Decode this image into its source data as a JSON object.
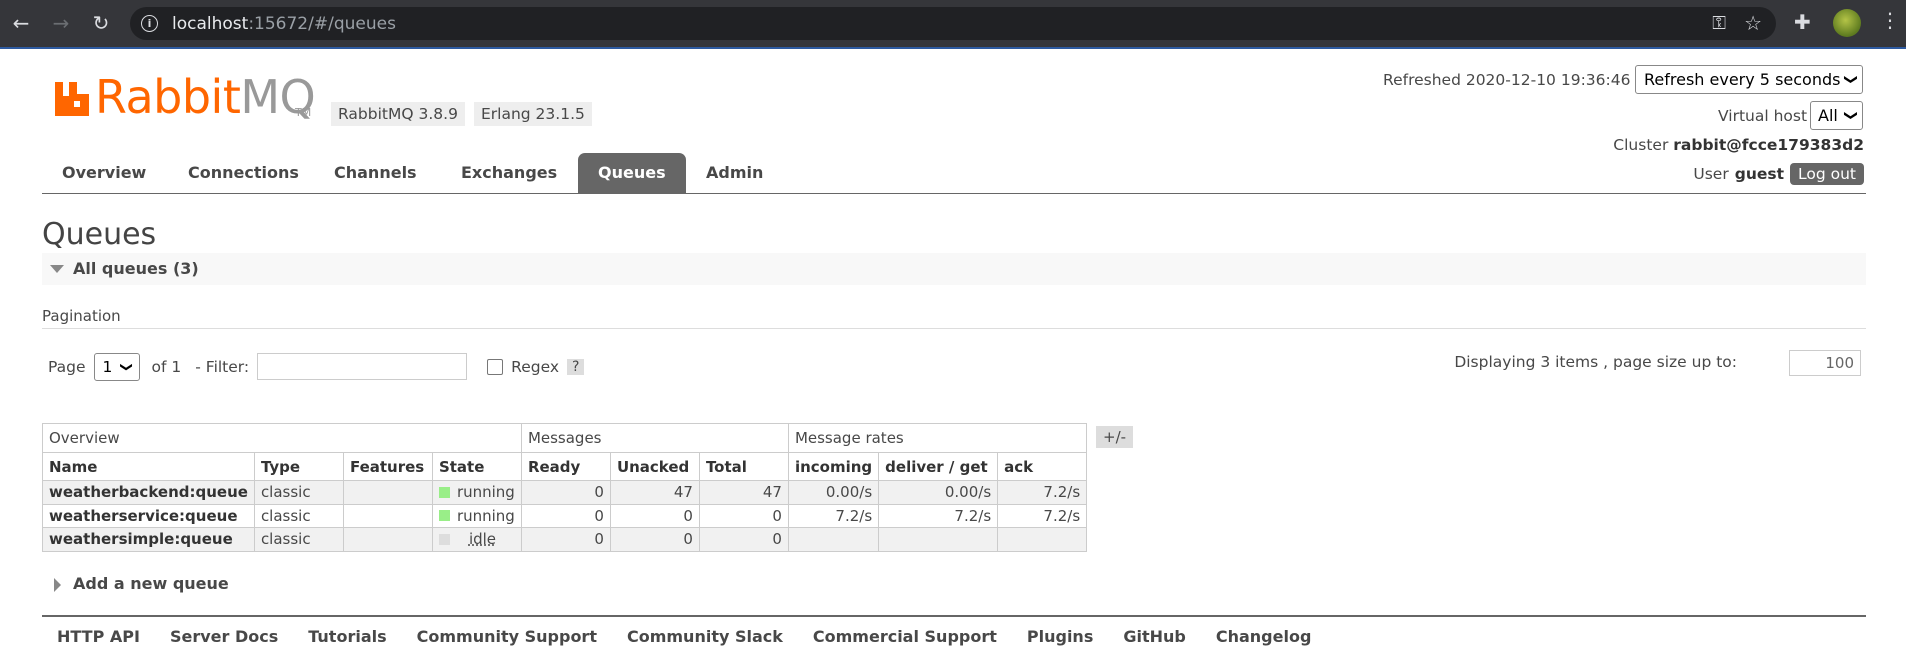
{
  "browser": {
    "url_host": "localhost",
    "url_rest": ":15672/#/queues"
  },
  "header": {
    "logo_rabbit": "Rabbit",
    "logo_mq": "MQ",
    "logo_tm": "TM",
    "version": "RabbitMQ 3.8.9",
    "erlang": "Erlang 23.1.5",
    "refreshed": "Refreshed 2020-12-10 19:36:46",
    "refresh_select": "Refresh every 5 seconds",
    "vhost_label": "Virtual host",
    "vhost_select": "All",
    "cluster_label": "Cluster",
    "cluster_value": "rabbit@fcce179383d2",
    "user_label": "User",
    "user_value": "guest",
    "logout": "Log out"
  },
  "tabs": [
    {
      "label": "Overview"
    },
    {
      "label": "Connections"
    },
    {
      "label": "Channels"
    },
    {
      "label": "Exchanges"
    },
    {
      "label": "Queues",
      "active": true
    },
    {
      "label": "Admin"
    }
  ],
  "page": {
    "title": "Queues",
    "section": "All queues (3)",
    "pagination_title": "Pagination",
    "page_label": "Page",
    "page_value": "1",
    "of_label": "of 1",
    "filter_label": "- Filter:",
    "regex_label": "Regex",
    "help": "?",
    "displaying": "Displaying 3 items , page size up to:",
    "page_size": "100",
    "plusminus": "+/-",
    "add_queue": "Add a new queue"
  },
  "table": {
    "groups": [
      "Overview",
      "Messages",
      "Message rates"
    ],
    "columns": [
      "Name",
      "Type",
      "Features",
      "State",
      "Ready",
      "Unacked",
      "Total",
      "incoming",
      "deliver / get",
      "ack"
    ],
    "rows": [
      {
        "name": "weatherbackend:queue",
        "type": "classic",
        "features": "",
        "state": "running",
        "ready": "0",
        "unacked": "47",
        "total": "47",
        "incoming": "0.00/s",
        "deliver": "0.00/s",
        "ack": "7.2/s"
      },
      {
        "name": "weatherservice:queue",
        "type": "classic",
        "features": "",
        "state": "running",
        "ready": "0",
        "unacked": "0",
        "total": "0",
        "incoming": "7.2/s",
        "deliver": "7.2/s",
        "ack": "7.2/s"
      },
      {
        "name": "weathersimple:queue",
        "type": "classic",
        "features": "",
        "state": "idle",
        "ready": "0",
        "unacked": "0",
        "total": "0",
        "incoming": "",
        "deliver": "",
        "ack": ""
      }
    ]
  },
  "footer": [
    "HTTP API",
    "Server Docs",
    "Tutorials",
    "Community Support",
    "Community Slack",
    "Commercial Support",
    "Plugins",
    "GitHub",
    "Changelog"
  ],
  "colors": {
    "accent": "#ff6600",
    "running": "#99ee88",
    "idle": "#dddddd"
  }
}
